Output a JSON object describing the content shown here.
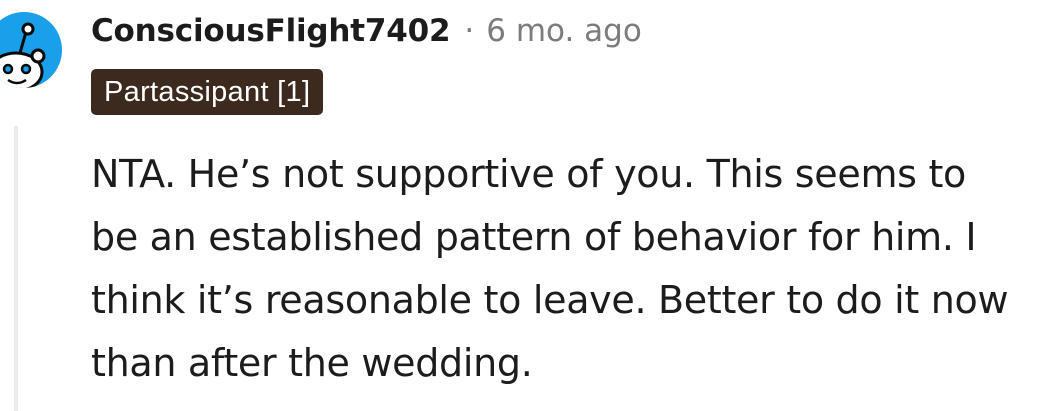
{
  "comment": {
    "author": "ConsciousFlight7402",
    "separator": "·",
    "timestamp": "6 mo. ago",
    "flair": "Partassipant [1]",
    "body_lines": [
      "NTA. He’s not supportive of you. This seems to",
      "be an established pattern of behavior for him. I",
      "think it’s reasonable to leave. Better to do it now",
      "than after the wedding."
    ],
    "avatar_icon": "snoo-avatar-icon",
    "colors": {
      "avatar_bg": "#1a9fea",
      "flair_bg": "#3b2a1d",
      "meta_text": "#7c7c7c"
    }
  }
}
